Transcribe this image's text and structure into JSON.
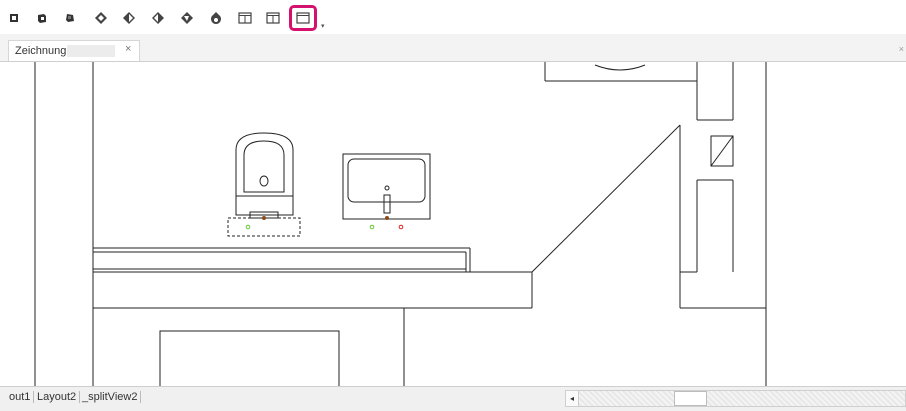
{
  "toolbar": {
    "icons": [
      "view-top-icon",
      "view-front-icon",
      "view-back-icon",
      "view-iso-sw-icon",
      "view-iso-se-icon",
      "view-iso-ne-icon",
      "view-iso-nw-icon",
      "render-icon",
      "split-view-vertical-icon",
      "split-view-horizontal-icon",
      "single-view-icon"
    ],
    "highlight_color": "#d4116f"
  },
  "document_tab": {
    "label": "Zeichnung",
    "close_glyph": "×"
  },
  "layout_tabs": [
    "out1",
    "Layout2",
    "_splitView2"
  ],
  "scrollbar": {
    "left_arrow": "◂"
  },
  "right_close": "×"
}
